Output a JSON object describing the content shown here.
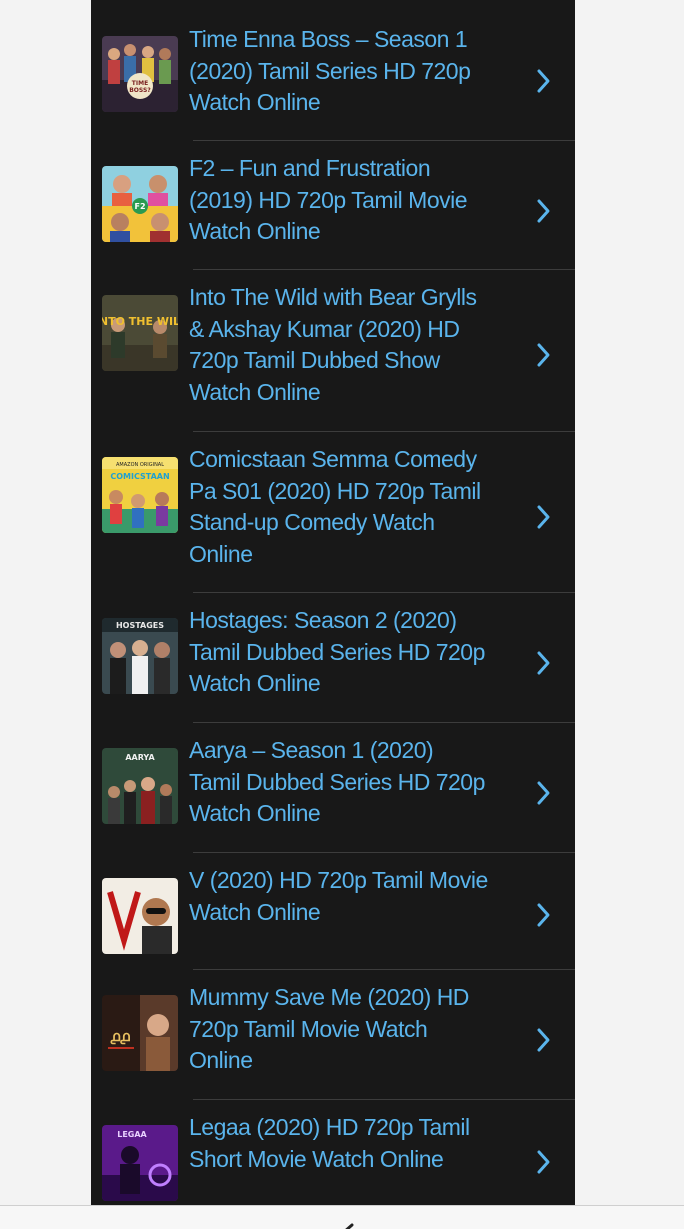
{
  "items": [
    {
      "title": "Time Enna Boss – Season 1 (2020) Tamil Series HD 720p Watch Online",
      "thumb_icon": "time-enna-boss-poster"
    },
    {
      "title": "F2 – Fun and Frustration (2019) HD 720p Tamil Movie Watch Online",
      "thumb_icon": "f2-poster"
    },
    {
      "title": "Into The Wild with Bear Grylls & Akshay Kumar (2020) HD 720p Tamil Dubbed Show Watch Online",
      "thumb_icon": "into-the-wild-poster"
    },
    {
      "title": "Comicstaan Semma Comedy Pa S01 (2020) HD 720p Tamil Stand-up Comedy Watch Online",
      "thumb_icon": "comicstaan-poster"
    },
    {
      "title": "Hostages: Season 2 (2020) Tamil Dubbed Series HD 720p Watch Online",
      "thumb_icon": "hostages-poster"
    },
    {
      "title": "Aarya – Season 1 (2020) Tamil Dubbed Series HD 720p Watch Online",
      "thumb_icon": "aarya-poster"
    },
    {
      "title": "V (2020) HD 720p Tamil Movie Watch Online",
      "thumb_icon": "v-poster"
    },
    {
      "title": "Mummy Save Me (2020) HD 720p Tamil Movie Watch Online",
      "thumb_icon": "mummy-save-me-poster"
    },
    {
      "title": "Legaa (2020) HD 720p Tamil Short Movie Watch Online",
      "thumb_icon": "legaa-poster"
    }
  ],
  "thumb_labels": {
    "into_the_wild": "INTO THE WILD",
    "amazon": "AMAZON ORIGINAL",
    "comicstaan": "COMICSTAAN",
    "hostages": "HOSTAGES",
    "aarya": "AARYA",
    "legaa": "LEGAA"
  },
  "colors": {
    "panel_bg": "#181818",
    "link": "#5ab4ec",
    "page_bg": "#f3f3f3",
    "divider": "#3c3c3c"
  },
  "bottom_bar": {
    "back_icon": "back-arrow-icon"
  }
}
